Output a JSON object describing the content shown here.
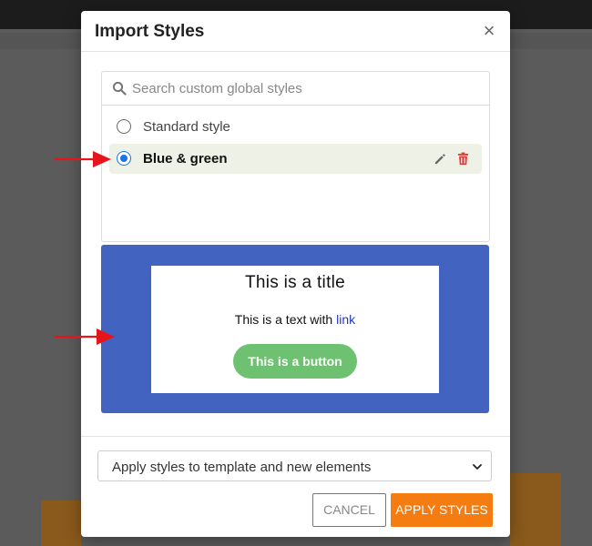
{
  "modal": {
    "title": "Import Styles",
    "close_label": "×"
  },
  "search": {
    "placeholder": "Search custom global styles",
    "value": ""
  },
  "styles": {
    "items": [
      {
        "label": "Standard style",
        "selected": false
      },
      {
        "label": "Blue & green",
        "selected": true
      }
    ]
  },
  "preview": {
    "title": "This is a title",
    "text": "This is a text with",
    "link": "link",
    "button": "This is a button"
  },
  "apply_select": {
    "selected": "Apply styles to template and new elements"
  },
  "buttons": {
    "cancel": "CANCEL",
    "apply": "APPLY STYLES"
  },
  "colors": {
    "preview_background": "#4264c0",
    "preview_button": "#6fc172",
    "preview_link": "#2438c8",
    "selected_row": "#eef1e6",
    "radio_checked": "#1a73e8",
    "apply_button": "#f57c11",
    "delete_icon": "#e53935",
    "annotation_arrow": "#e8141b"
  },
  "icons": {
    "search": "search-icon",
    "edit": "pencil-icon",
    "delete": "trash-icon",
    "chevron": "chevron-down-icon",
    "close": "close-icon"
  }
}
